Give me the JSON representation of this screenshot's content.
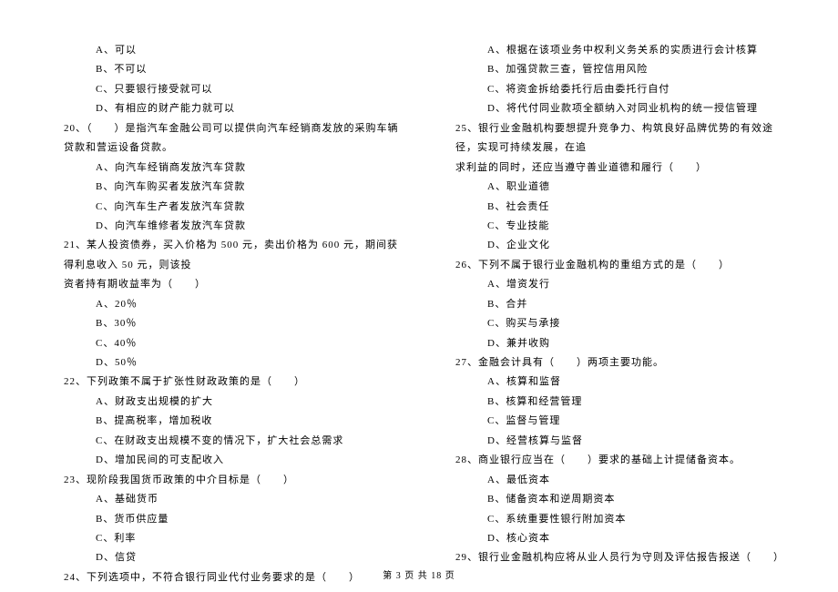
{
  "left_column": {
    "q19_options": {
      "a": "A、可以",
      "b": "B、不可以",
      "c": "C、只要银行接受就可以",
      "d": "D、有相应的财产能力就可以"
    },
    "q20": "20、（　　）是指汽车金融公司可以提供向汽车经销商发放的采购车辆贷款和营运设备贷款。",
    "q20_options": {
      "a": "A、向汽车经销商发放汽车贷款",
      "b": "B、向汽车购买者发放汽车贷款",
      "c": "C、向汽车生产者发放汽车贷款",
      "d": "D、向汽车维修者发放汽车贷款"
    },
    "q21_line1": "21、某人投资债券，买入价格为 500 元，卖出价格为 600 元，期间获得利息收入 50 元，则该投",
    "q21_line2": "资者持有期收益率为（　　）",
    "q21_options": {
      "a": "A、20％",
      "b": "B、30％",
      "c": "C、40％",
      "d": "D、50％"
    },
    "q22": "22、下列政策不属于扩张性财政政策的是（　　）",
    "q22_options": {
      "a": "A、财政支出规模的扩大",
      "b": "B、提高税率，增加税收",
      "c": "C、在财政支出规模不变的情况下，扩大社会总需求",
      "d": "D、增加民间的可支配收入"
    },
    "q23": "23、现阶段我国货币政策的中介目标是（　　）",
    "q23_options": {
      "a": "A、基础货币",
      "b": "B、货币供应量",
      "c": "C、利率",
      "d": "D、信贷"
    },
    "q24": "24、下列选项中，不符合银行同业代付业务要求的是（　　）"
  },
  "right_column": {
    "q24_options": {
      "a": "A、根据在该项业务中权利义务关系的实质进行会计核算",
      "b": "B、加强贷款三查，管控信用风险",
      "c": "C、将资金拆给委托行后由委托行自付",
      "d": "D、将代付同业款项全额纳入对同业机构的统一授信管理"
    },
    "q25_line1": "25、银行业金融机构要想提升竞争力、构筑良好品牌优势的有效途径，实现可持续发展，在追",
    "q25_line2": "求利益的同时，还应当遵守善业道德和履行（　　）",
    "q25_options": {
      "a": "A、职业道德",
      "b": "B、社会责任",
      "c": "C、专业技能",
      "d": "D、企业文化"
    },
    "q26": "26、下列不属于银行业金融机构的重组方式的是（　　）",
    "q26_options": {
      "a": "A、增资发行",
      "b": "B、合并",
      "c": "C、购买与承接",
      "d": "D、兼并收购"
    },
    "q27": "27、金融会计具有（　　）两项主要功能。",
    "q27_options": {
      "a": "A、核算和监督",
      "b": "B、核算和经营管理",
      "c": "C、监督与管理",
      "d": "D、经营核算与监督"
    },
    "q28": "28、商业银行应当在（　　）要求的基础上计提储备资本。",
    "q28_options": {
      "a": "A、最低资本",
      "b": "B、储备资本和逆周期资本",
      "c": "C、系统重要性银行附加资本",
      "d": "D、核心资本"
    },
    "q29": "29、银行业金融机构应将从业人员行为守则及评估报告报送（　　）"
  },
  "footer": "第 3 页 共 18 页"
}
